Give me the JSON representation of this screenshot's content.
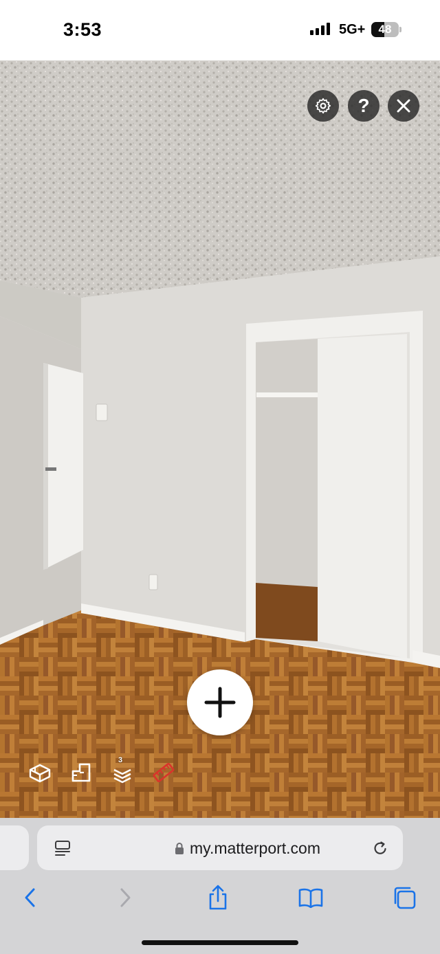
{
  "status_bar": {
    "time": "3:53",
    "network": "5G+",
    "battery_level": "48",
    "battery_fraction": 0.48
  },
  "viewer": {
    "top_controls": [
      {
        "icon": "gear-icon"
      },
      {
        "icon": "help-icon",
        "glyph": "?"
      },
      {
        "icon": "close-icon"
      }
    ],
    "navigate_icon": "plus-icon",
    "toolbar": [
      {
        "icon": "dollhouse-icon"
      },
      {
        "icon": "floorplan-icon"
      },
      {
        "icon": "floors-icon",
        "badge": "3"
      },
      {
        "icon": "measure-icon",
        "color": "#d9342b"
      }
    ]
  },
  "browser": {
    "url": "my.matterport.com",
    "accent_color": "#1a73e8",
    "nav": [
      {
        "icon": "back-icon",
        "enabled": true
      },
      {
        "icon": "forward-icon",
        "enabled": false
      },
      {
        "icon": "share-icon"
      },
      {
        "icon": "bookmarks-icon"
      },
      {
        "icon": "tabs-icon"
      }
    ]
  }
}
